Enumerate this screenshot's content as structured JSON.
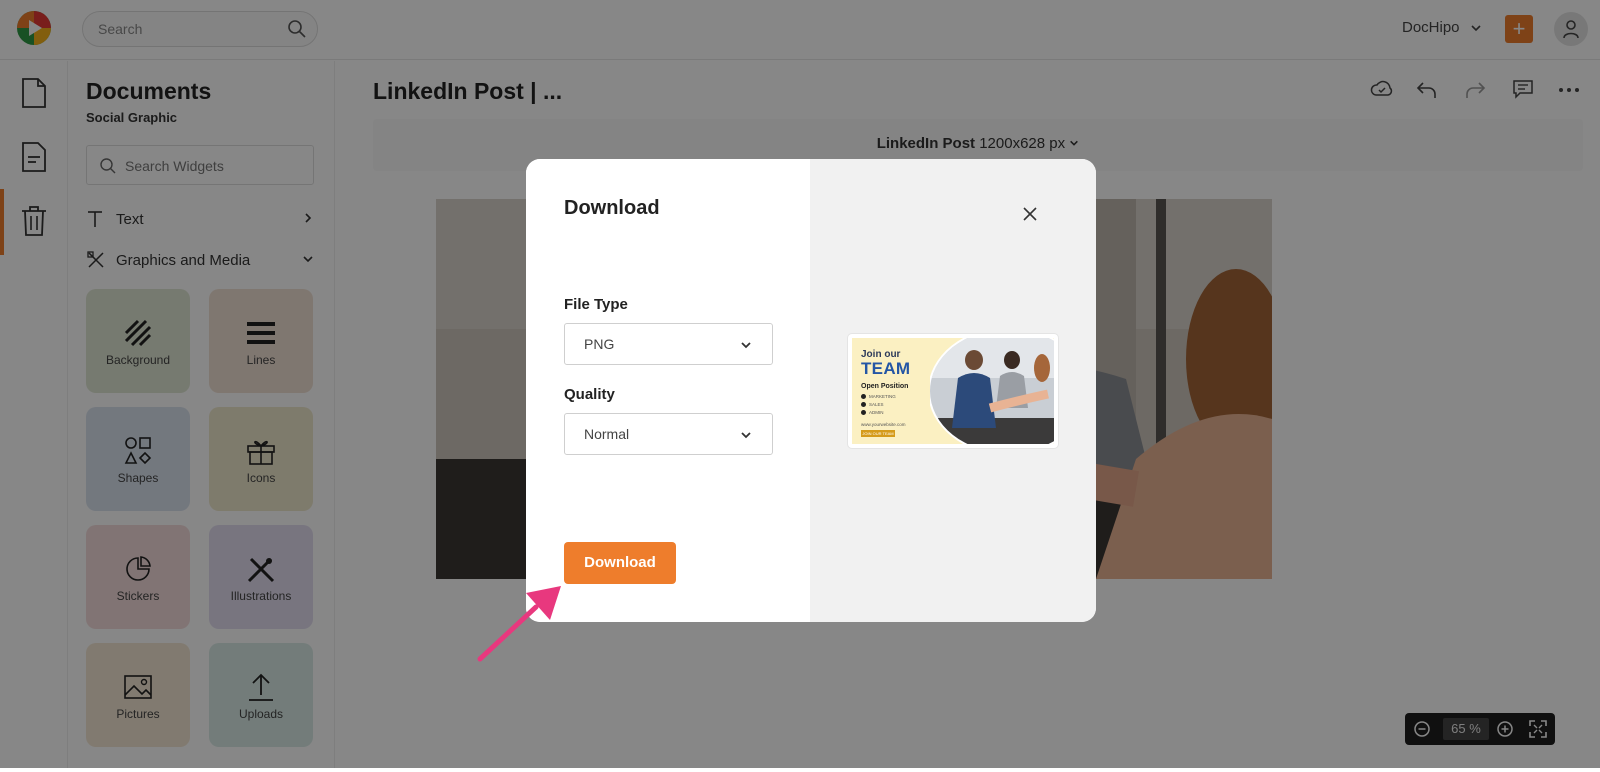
{
  "topbar": {
    "search_placeholder": "Search",
    "account_name": "DocHipo",
    "plus_label": "+"
  },
  "panel": {
    "title": "Documents",
    "subtitle": "Social Graphic",
    "search_placeholder": "Search Widgets",
    "categories": [
      {
        "label": "Text",
        "icon": "text-icon"
      },
      {
        "label": "Graphics and Media",
        "icon": "graphics-media-icon"
      }
    ],
    "tiles": [
      {
        "label": "Background",
        "color": "#dfe6d3"
      },
      {
        "label": "Lines",
        "color": "#f0e0d4"
      },
      {
        "label": "Shapes",
        "color": "#d9e2ef"
      },
      {
        "label": "Icons",
        "color": "#efe8cd"
      },
      {
        "label": "Stickers",
        "color": "#f3dcdb"
      },
      {
        "label": "Illustrations",
        "color": "#e2def0"
      },
      {
        "label": "Pictures",
        "color": "#f3e6d3"
      },
      {
        "label": "Uploads",
        "color": "#d9ebe6"
      }
    ]
  },
  "editor": {
    "doc_title": "LinkedIn Post | ...",
    "size_name": "LinkedIn Post",
    "size_dims": "1200x628 px",
    "zoom_value": "65 %"
  },
  "modal": {
    "title": "Download",
    "file_type_label": "File Type",
    "file_type_value": "PNG",
    "quality_label": "Quality",
    "quality_value": "Normal",
    "download_label": "Download",
    "preview": {
      "join": "Join our",
      "team": "TEAM",
      "open": "Open Position",
      "items": [
        "MARKETING",
        "SALES",
        "ADMIN"
      ],
      "web": "www.yourwebsite.com",
      "apply": "JOIN OUR TEAM"
    }
  },
  "colors": {
    "accent": "#ee7d2c",
    "annotation_arrow": "#e8387e"
  }
}
